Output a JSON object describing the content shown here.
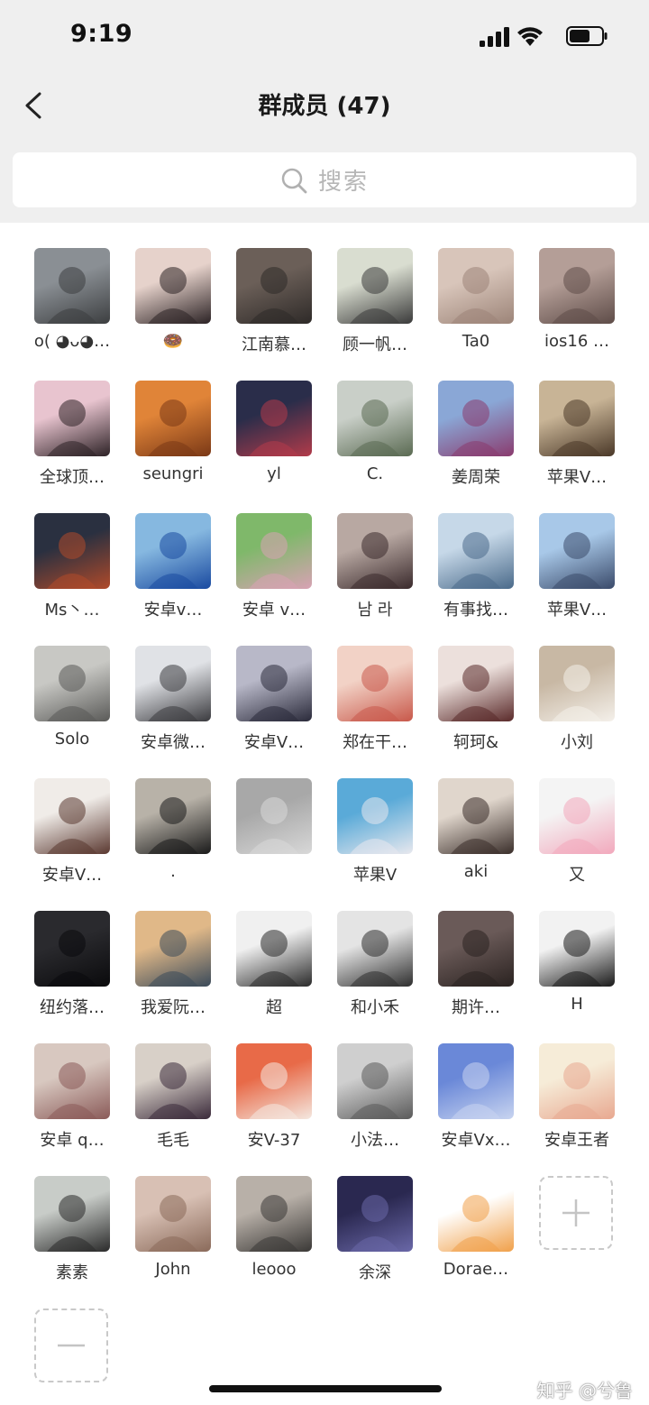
{
  "status_bar": {
    "time": "9:19"
  },
  "header": {
    "title": "群成员 (47)"
  },
  "search": {
    "placeholder": "搜索"
  },
  "members": [
    {
      "name": "o( ◕ᴗ◕…",
      "colors": [
        "#8a8f94",
        "#3c3e40"
      ]
    },
    {
      "name": "🍩",
      "colors": [
        "#e6d2cb",
        "#2b2224"
      ]
    },
    {
      "name": "江南慕…",
      "colors": [
        "#6b5f58",
        "#2e2a28"
      ]
    },
    {
      "name": "顾一帆…",
      "colors": [
        "#d9ddd0",
        "#3a3a3a"
      ]
    },
    {
      "name": "Ta0",
      "colors": [
        "#d8c5ba",
        "#9c8478"
      ]
    },
    {
      "name": "ios16 …",
      "colors": [
        "#b49e97",
        "#5e4c48"
      ]
    },
    {
      "name": "全球顶…",
      "colors": [
        "#e8c4cf",
        "#2d2226"
      ]
    },
    {
      "name": "seungri",
      "colors": [
        "#e08438",
        "#7a3816"
      ]
    },
    {
      "name": "yl",
      "colors": [
        "#2a2d4a",
        "#b23b4a"
      ]
    },
    {
      "name": "C.",
      "colors": [
        "#c9cfc8",
        "#5a6a52"
      ]
    },
    {
      "name": "姜周荣",
      "colors": [
        "#8aa7d6",
        "#8a3b6e"
      ]
    },
    {
      "name": "苹果V…",
      "colors": [
        "#c8b496",
        "#4a3828"
      ]
    },
    {
      "name": "Ms丶…",
      "colors": [
        "#2a3040",
        "#b04a2a"
      ]
    },
    {
      "name": "安卓v…",
      "colors": [
        "#86b8e0",
        "#1a4aa0"
      ]
    },
    {
      "name": "安卓 v…",
      "colors": [
        "#7fb86a",
        "#d8a2b4"
      ]
    },
    {
      "name": "남 라",
      "colors": [
        "#b8a8a2",
        "#3a2a2c"
      ]
    },
    {
      "name": "有事找…",
      "colors": [
        "#c6d8e8",
        "#4a6a8a"
      ]
    },
    {
      "name": "苹果V…",
      "colors": [
        "#a8c8e8",
        "#3a4a6a"
      ]
    },
    {
      "name": "Solo",
      "colors": [
        "#c8c8c4",
        "#5a5a58"
      ]
    },
    {
      "name": "安卓微…",
      "colors": [
        "#e0e2e6",
        "#3a3a3e"
      ]
    },
    {
      "name": "安卓V…",
      "colors": [
        "#b8b8c8",
        "#2a2a3a"
      ]
    },
    {
      "name": "郑在干…",
      "colors": [
        "#f2d2c6",
        "#c8584a"
      ]
    },
    {
      "name": "轲珂&",
      "colors": [
        "#ece0dc",
        "#5a2a2a"
      ]
    },
    {
      "name": "小刘",
      "colors": [
        "#c8b8a4",
        "#f4f0ea"
      ]
    },
    {
      "name": "安卓V…",
      "colors": [
        "#f0ece8",
        "#5a3830"
      ]
    },
    {
      "name": ".",
      "colors": [
        "#b8b2a8",
        "#1a1a1a"
      ]
    },
    {
      "name": "",
      "colors": [
        "#a8a8a8",
        "#d8d8d8"
      ]
    },
    {
      "name": "苹果V",
      "colors": [
        "#5aaad8",
        "#e8e8ee"
      ]
    },
    {
      "name": "aki",
      "colors": [
        "#e0d6cc",
        "#3a2e2a"
      ]
    },
    {
      "name": "又",
      "colors": [
        "#f4f4f4",
        "#f2a8bc"
      ]
    },
    {
      "name": "纽约落…",
      "colors": [
        "#2a2a2e",
        "#0a0a0c"
      ]
    },
    {
      "name": "我爱阮…",
      "colors": [
        "#e0b888",
        "#3a4a5a"
      ]
    },
    {
      "name": "超",
      "colors": [
        "#f0f0f0",
        "#2a2a2a"
      ]
    },
    {
      "name": "和小禾",
      "colors": [
        "#e4e4e4",
        "#2e2e2e"
      ]
    },
    {
      "name": "期许…",
      "colors": [
        "#6a5a58",
        "#2a2220"
      ]
    },
    {
      "name": "H",
      "colors": [
        "#f2f2f2",
        "#1a1a1a"
      ]
    },
    {
      "name": "安卓 q…",
      "colors": [
        "#d8c8c0",
        "#8a5a58"
      ]
    },
    {
      "name": "毛毛",
      "colors": [
        "#d8d0c8",
        "#3a2a3a"
      ]
    },
    {
      "name": "安V-37",
      "colors": [
        "#e86a48",
        "#f4e8e0"
      ]
    },
    {
      "name": "小法…",
      "colors": [
        "#cfcfcf",
        "#5a5a5a"
      ]
    },
    {
      "name": "安卓Vx…",
      "colors": [
        "#6a88d8",
        "#c8d4f0"
      ]
    },
    {
      "name": "安卓王者",
      "colors": [
        "#f6ecd8",
        "#e8a890"
      ]
    },
    {
      "name": "素素",
      "colors": [
        "#c8ccc8",
        "#2a2a2a"
      ]
    },
    {
      "name": "John",
      "colors": [
        "#d8c0b4",
        "#8a6a5a"
      ]
    },
    {
      "name": "leooo",
      "colors": [
        "#b8b0a8",
        "#3a3836"
      ]
    },
    {
      "name": "余深",
      "colors": [
        "#2a2850",
        "#6a68a8"
      ]
    },
    {
      "name": "Dorae…",
      "colors": [
        "#ffffff",
        "#f0a04a"
      ]
    }
  ],
  "actions": {
    "add": "add-member",
    "remove": "remove-member"
  },
  "watermark": "知乎 @兮鲁"
}
